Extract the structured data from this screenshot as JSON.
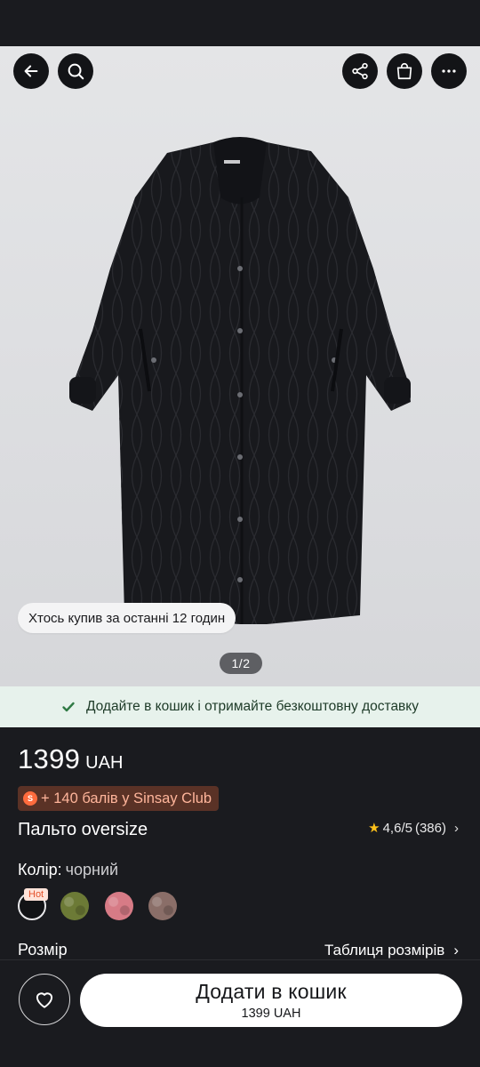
{
  "gallery": {
    "recent_purchase": "Хтось купив за останні 12 годин",
    "pager": "1/2"
  },
  "top_actions": {
    "back": "arrow-left-icon",
    "search": "search-icon",
    "share": "share-icon",
    "bag": "bag-icon",
    "more": "more-icon"
  },
  "promo": {
    "text": "Додайте в кошик і отримайте безкоштовну доставку"
  },
  "product": {
    "price": "1399",
    "currency": "UAH",
    "points": "+ 140 балів у Sinsay Club",
    "name": "Пальто oversize",
    "rating": "4,6/5",
    "reviews": "(386)",
    "color_label": "Колір:",
    "color_value": "чорний",
    "hot_badge": "Hot",
    "swatches": [
      {
        "name": "black",
        "color": "#121316"
      },
      {
        "name": "olive",
        "color": "#6c7a36"
      },
      {
        "name": "pink",
        "color": "#d77b86"
      },
      {
        "name": "taupe",
        "color": "#8a6e68"
      }
    ],
    "size_label": "Розмір",
    "size_table": "Таблиця розмірів"
  },
  "cart": {
    "add_label": "Додати в кошик",
    "price_line": "1399 UAH"
  },
  "colors": {
    "background": "#1a1b1f",
    "promo_bg": "#e7f2ec",
    "promo_check": "#2f7a44",
    "points_bg": "#5a3226",
    "points_text": "#ffb59b",
    "star": "#ffc21a"
  }
}
